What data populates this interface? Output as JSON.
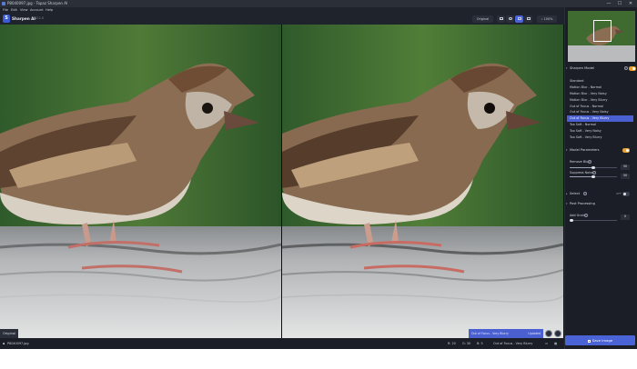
{
  "window": {
    "title": "P8040097.jpg - Topaz Sharpen AI",
    "controls": [
      "—",
      "☐",
      "✕"
    ]
  },
  "menu": [
    "File",
    "Edit",
    "View",
    "Account",
    "Help"
  ],
  "toolbar": {
    "app_name": "Sharpen AI",
    "version": "v2.1.0",
    "original_label": "Original",
    "zoom": "100%",
    "view_modes": [
      "single-view-icon",
      "compare-circle-icon",
      "split-view-icon",
      "side-by-side-icon"
    ],
    "active_view_index": 2
  },
  "canvas": {
    "left_label": "Original",
    "right_status_model": "Out of Focus - Very Blurry",
    "right_status_state": "Updated"
  },
  "statusbar": {
    "filename": "P8040097.jpg",
    "r_label": "R: 20",
    "g_label": "G: 30",
    "b_label": "B: 5",
    "model": "Out of Focus - Very Blurry"
  },
  "panel": {
    "sharpen_model_title": "Sharpen Model",
    "models": [
      "Standard",
      "Motion Blur - Normal",
      "Motion Blur - Very Noisy",
      "Motion Blur - Very Blurry",
      "Out of Focus - Normal",
      "Out of Focus - Very Noisy",
      "Out of Focus - Very Blurry",
      "Too Soft - Normal",
      "Too Soft - Very Noisy",
      "Too Soft - Very Blurry"
    ],
    "selected_model_index": 6,
    "model_parameters_title": "Model Parameters",
    "model_parameters_on": true,
    "remove_blur_label": "Remove Blur",
    "remove_blur_value": "50",
    "remove_blur_level": 0.5,
    "suppress_noise_label": "Suppress Noise",
    "suppress_noise_value": "50",
    "suppress_noise_level": 0.5,
    "select_title": "Select",
    "select_state": "OFF",
    "post_processing_title": "Post Processing",
    "add_grain_label": "Add Grain",
    "add_grain_value": "0",
    "add_grain_level": 0.0,
    "save_label": "Save Image"
  },
  "colors": {
    "accent": "#4a63d6",
    "toggle_on": "#e9a233",
    "background": "#1b1e26"
  }
}
